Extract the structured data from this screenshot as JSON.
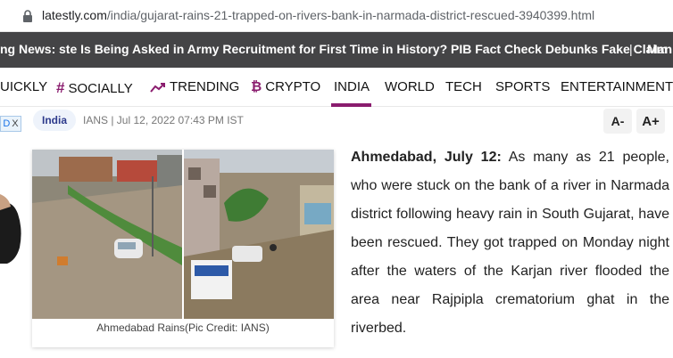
{
  "browser": {
    "url_host": "latestly.com",
    "url_path": "/india/gujarat-rains-21-trapped-on-rivers-bank-in-narmada-district-rescued-3940399.html"
  },
  "ticker": {
    "label": "ng News:",
    "headline": "ste Is Being Asked in Army Recruitment for First Time in History? PIB Fact Check Debunks Fake Claim",
    "separator": "|",
    "next": "Man"
  },
  "nav": {
    "items": [
      {
        "label": "UICKLY",
        "icon": ""
      },
      {
        "label": "SOCIALLY",
        "icon": "hashtag-icon"
      },
      {
        "label": "TRENDING",
        "icon": "trending-icon"
      },
      {
        "label": "CRYPTO",
        "icon": "crypto-icon"
      },
      {
        "label": "INDIA",
        "icon": ""
      },
      {
        "label": "WORLD",
        "icon": ""
      },
      {
        "label": "TECH",
        "icon": ""
      },
      {
        "label": "SPORTS",
        "icon": ""
      },
      {
        "label": "ENTERTAINMENT",
        "icon": ""
      }
    ],
    "active": "INDIA",
    "accent_color": "#8a1c6e"
  },
  "article": {
    "category_tag": "India",
    "byline": "IANS | Jul 12, 2022 07:43 PM IST",
    "font_decrease": "A-",
    "font_increase": "A+",
    "image_caption": "Ahmedabad Rains(Pic Credit: IANS)",
    "lead": "Ahmedabad, July 12:",
    "body": "As many as 21 people, who were stuck on the bank of a river in Narmada district following heavy rain in South Gujarat, have been rescued. They got trapped on Monday night after the waters of the Karjan river flooded the area near Rajpipla crematorium ghat in the riverbed."
  },
  "ad": {
    "badge": "D",
    "close": "X"
  }
}
